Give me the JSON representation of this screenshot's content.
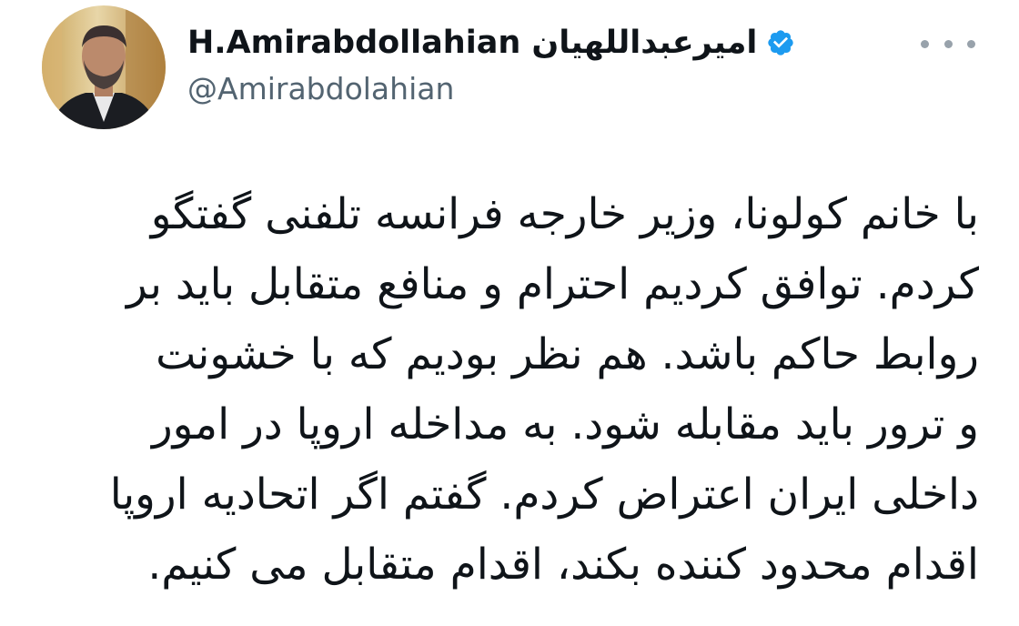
{
  "tweet": {
    "display_name": "H.Amirabdollahian اميرعبداللهيان",
    "handle": "@Amirabdolahian",
    "verified": true,
    "more_icon": "more-horizontal-icon",
    "body_lines": [
      "با خانم کولونا، وزیر خارجه فرانسه تلفنی گفتگو",
      "کردم. توافق کردیم احترام و منافع متقابل باید بر",
      "روابط حاکم باشد. هم نظر بودیم که با خشونت",
      "و ترور باید مقابله شود. به مداخله اروپا در امور",
      "داخلی ایران اعتراض کردم. گفتم اگر اتحادیه اروپا",
      "اقدام محدود کننده بکند، اقدام متقابل می کنیم."
    ]
  },
  "colors": {
    "text_primary": "#0f1419",
    "text_secondary": "#536471",
    "verified_blue": "#1d9bf0",
    "background": "#ffffff"
  }
}
